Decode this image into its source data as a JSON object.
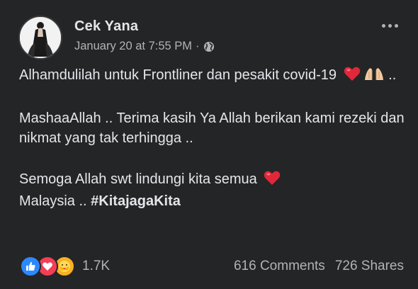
{
  "post": {
    "author": "Cek Yana",
    "timestamp": "January 20 at 7:55 PM",
    "separator": "·",
    "privacy_icon": "globe-icon",
    "more_icon": "more-options-icon"
  },
  "content": {
    "line1": "Alhamdulilah untuk Frontliner dan pesakit covid-19",
    "line1_suffix": "..",
    "para2": "MashaaAllah .. Terima kasih Ya Allah berikan kami rezeki dan nikmat yang tak terhingga ..",
    "para3_text": "Semoga Allah swt lindungi kita semua",
    "para3_text2": "Malaysia ..",
    "hashtag": "#KitajagaKita"
  },
  "footer": {
    "reaction_icons": [
      "like-icon",
      "love-icon",
      "care-icon"
    ],
    "reaction_count": "1.7K",
    "comments": "616 Comments",
    "shares": "726 Shares"
  },
  "colors": {
    "background": "#242526",
    "text": "#e4e6eb",
    "secondary_text": "#b0b3b8",
    "like": "#2d88ff",
    "love": "#f33e58",
    "care": "#f7b125"
  }
}
